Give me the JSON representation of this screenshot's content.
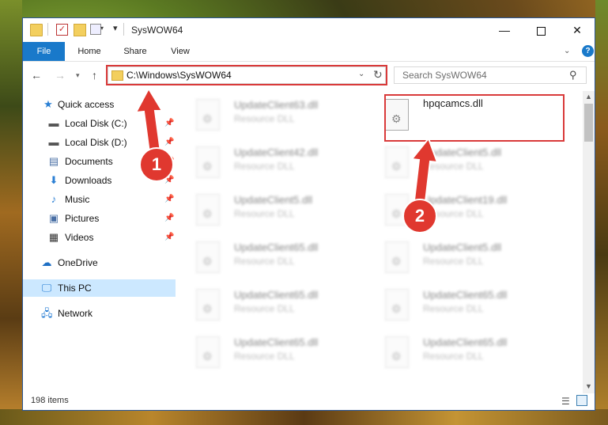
{
  "window": {
    "title": "SysWOW64"
  },
  "ribbon": {
    "tabs": [
      {
        "label": "File"
      },
      {
        "label": "Home"
      },
      {
        "label": "Share"
      },
      {
        "label": "View"
      }
    ]
  },
  "address": {
    "path": "C:\\Windows\\SysWOW64",
    "search_placeholder": "Search SysWOW64"
  },
  "sidebar": {
    "items": [
      {
        "label": "Quick access",
        "icon": "star-icon"
      },
      {
        "label": "Local Disk (C:)",
        "icon": "drive-icon",
        "pinned": true
      },
      {
        "label": "Local Disk (D:)",
        "icon": "drive-icon",
        "pinned": true
      },
      {
        "label": "Documents",
        "icon": "documents-icon",
        "pinned": true
      },
      {
        "label": "Downloads",
        "icon": "download-icon",
        "pinned": true
      },
      {
        "label": "Music",
        "icon": "music-icon",
        "pinned": true
      },
      {
        "label": "Pictures",
        "icon": "pictures-icon",
        "pinned": true
      },
      {
        "label": "Videos",
        "icon": "videos-icon",
        "pinned": true
      },
      {
        "label": "OneDrive",
        "icon": "cloud-icon"
      },
      {
        "label": "This PC",
        "icon": "computer-icon",
        "selected": true
      },
      {
        "label": "Network",
        "icon": "network-icon"
      }
    ]
  },
  "files": {
    "highlighted": {
      "name": "hpqcamcs.dll"
    },
    "left_column": [
      {
        "name": "UpdateClient63.dll",
        "type": "Resource DLL"
      },
      {
        "name": "UpdateClient42.dll",
        "type": "Resource DLL"
      },
      {
        "name": "UpdateClient5.dll",
        "type": "Resource DLL"
      },
      {
        "name": "UpdateClient65.dll",
        "type": "Resource DLL"
      },
      {
        "name": "UpdateClient65.dll",
        "type": "Resource DLL"
      },
      {
        "name": "UpdateClient65.dll",
        "type": "Resource DLL"
      }
    ],
    "right_column": [
      {
        "name": "UpdateClient5.dll",
        "type": "Resource DLL"
      },
      {
        "name": "UpdateClient19.dll",
        "type": "Resource DLL"
      },
      {
        "name": "UpdateClient5.dll",
        "type": "Resource DLL"
      },
      {
        "name": "UpdateClient65.dll",
        "type": "Resource DLL"
      },
      {
        "name": "UpdateClient65.dll",
        "type": "Resource DLL"
      }
    ]
  },
  "status": {
    "item_count": "198 items"
  },
  "annotations": {
    "step1": "1",
    "step2": "2",
    "color": "#e0382f"
  }
}
